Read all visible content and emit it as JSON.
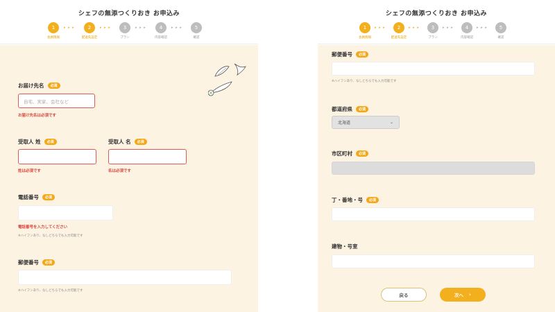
{
  "title": "シェフの無添つくりおき お申込み",
  "steps": [
    {
      "num": "1",
      "label": "会員情報"
    },
    {
      "num": "2",
      "label": "配送先設定"
    },
    {
      "num": "3",
      "label": "プラン"
    },
    {
      "num": "4",
      "label": "内容確認"
    },
    {
      "num": "5",
      "label": "確認"
    }
  ],
  "arrow_glyph": "▸ ▸ ▸",
  "required": "必須",
  "left": {
    "delivery_name": {
      "label": "お届け先名",
      "placeholder": "自宅、実家、会社など",
      "error": "お届け先名は必須です"
    },
    "last_name": {
      "label": "受取人 姓",
      "error": "姓は必須です"
    },
    "first_name": {
      "label": "受取人 名",
      "error": "名は必須です"
    },
    "phone": {
      "label": "電話番号",
      "error": "電話番号を入力してください",
      "hint": "※ハイフンあり、なしどちらでも入力可能です"
    },
    "postal": {
      "label": "郵便番号",
      "hint": "※ハイフンあり、なしどちらでも入力可能です"
    }
  },
  "right": {
    "postal": {
      "label": "郵便番号",
      "hint": "※ハイフンあり、なしどちらでも入力可能です"
    },
    "prefecture": {
      "label": "都道府県",
      "value": "北海道"
    },
    "city": {
      "label": "市区町村"
    },
    "street": {
      "label": "丁・番地・号"
    },
    "building": {
      "label": "建物・号室"
    },
    "back_button": "戻る",
    "next_button": "次へ"
  },
  "colors": {
    "accent": "#f2b01e",
    "background": "#fdf3e3",
    "error": "#d9453e"
  }
}
